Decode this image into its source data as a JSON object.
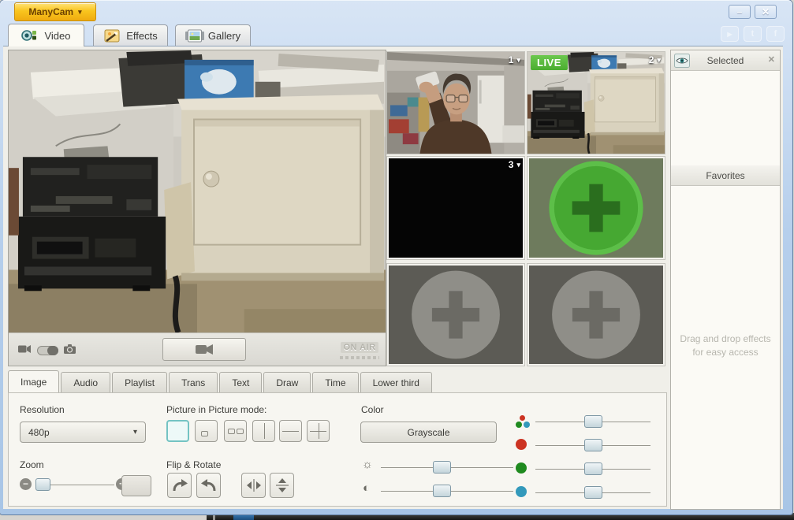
{
  "window": {
    "app_button": "ManyCam",
    "minimize_glyph": "–",
    "close_glyph": "✕"
  },
  "main_tabs": {
    "video": "Video",
    "effects": "Effects",
    "gallery": "Gallery"
  },
  "icons": {
    "dropdown_caret": "▾",
    "thumb_caret": "▾",
    "youtube": "▶",
    "twitter": "t",
    "facebook": "f",
    "minus": "−",
    "plus": "+",
    "brightness": "☼",
    "contrast": "◐",
    "panel_close": "✕",
    "add_source": "+"
  },
  "preview": {
    "on_air": "ON AIR"
  },
  "thumbnails": [
    {
      "label": "1"
    },
    {
      "label": "2",
      "badge": "LIVE"
    },
    {
      "label": "3"
    },
    {
      "label": ""
    },
    {
      "label": ""
    },
    {
      "label": ""
    }
  ],
  "effects_panel": {
    "selected_title": "Selected",
    "favorites_title": "Favorites",
    "hint": "Drag and drop effects for easy access"
  },
  "settings_tabs": [
    "Image",
    "Audio",
    "Playlist",
    "Trans",
    "Text",
    "Draw",
    "Time",
    "Lower third"
  ],
  "image_settings": {
    "resolution_label": "Resolution",
    "resolution_value": "480p",
    "zoom_label": "Zoom",
    "pip_label": "Picture in Picture mode:",
    "flip_label": "Flip & Rotate",
    "color_label": "Color",
    "grayscale_button": "Grayscale"
  },
  "slider_positions": {
    "zoom": 11,
    "brightness": 46,
    "contrast": 46,
    "rgb_master": 50,
    "red": 50,
    "green": 50,
    "blue": 50
  },
  "colors": {
    "live_badge_green": "#4aad30",
    "add_button_green": "#46a832",
    "selected_accent_teal": "#74c3c3",
    "app_button_yellow": "#f9c51e",
    "chrome_blue": "#b6cfec",
    "red_channel": "#cc3322",
    "green_channel": "#1f8a1f",
    "blue_channel": "#3399bb"
  }
}
